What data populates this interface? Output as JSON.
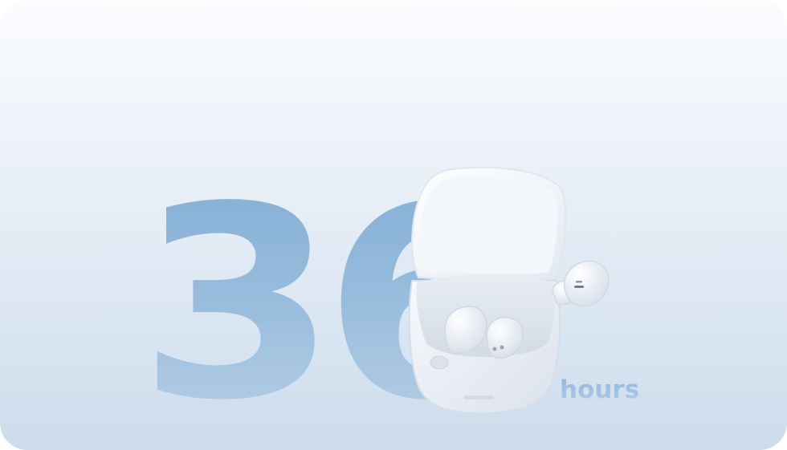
{
  "feature": {
    "number": "36",
    "unit": "hours"
  },
  "colors": {
    "number_gradient_top": "#85afd4",
    "number_gradient_bottom": "#b6cfe6",
    "background_top": "#fbfcfe",
    "background_bottom": "#cddcec"
  }
}
